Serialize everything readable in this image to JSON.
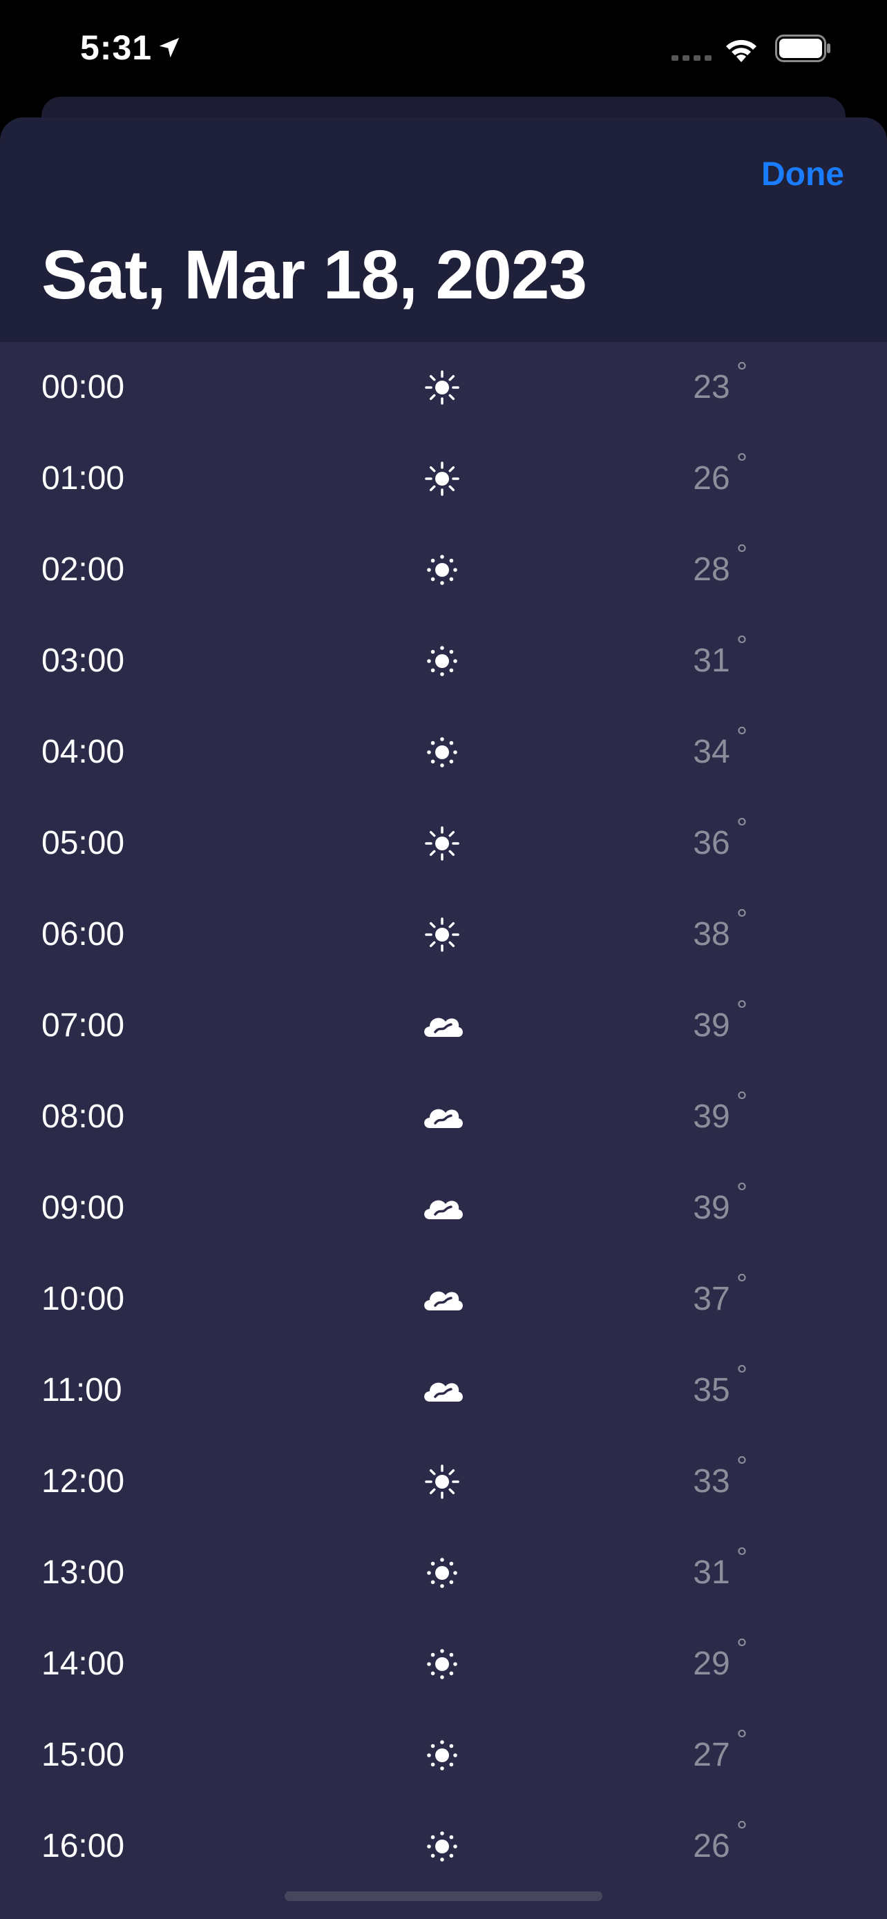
{
  "status_bar": {
    "time": "5:31",
    "location_icon": "location-arrow-icon",
    "signal_icon": "cellular-signal-icon",
    "wifi_icon": "wifi-icon",
    "battery_icon": "battery-icon"
  },
  "header": {
    "done_label": "Done",
    "title": "Sat, Mar 18, 2023"
  },
  "colors": {
    "accent": "#1a7cff",
    "header_bg": "#1f2039",
    "list_bg": "#2b2b49",
    "temp_text": "#8d8d9b"
  },
  "degree_symbol": "°",
  "hours": [
    {
      "time": "00:00",
      "icon": "sun",
      "temp": "23"
    },
    {
      "time": "01:00",
      "icon": "sun",
      "temp": "26"
    },
    {
      "time": "02:00",
      "icon": "sun-dotted",
      "temp": "28"
    },
    {
      "time": "03:00",
      "icon": "sun-dotted",
      "temp": "31"
    },
    {
      "time": "04:00",
      "icon": "sun-dotted",
      "temp": "34"
    },
    {
      "time": "05:00",
      "icon": "sun",
      "temp": "36"
    },
    {
      "time": "06:00",
      "icon": "sun",
      "temp": "38"
    },
    {
      "time": "07:00",
      "icon": "cloud-wind",
      "temp": "39"
    },
    {
      "time": "08:00",
      "icon": "cloud-wind",
      "temp": "39"
    },
    {
      "time": "09:00",
      "icon": "cloud-wind",
      "temp": "39"
    },
    {
      "time": "10:00",
      "icon": "cloud-wind",
      "temp": "37"
    },
    {
      "time": "11:00",
      "icon": "cloud-wind",
      "temp": "35"
    },
    {
      "time": "12:00",
      "icon": "sun",
      "temp": "33"
    },
    {
      "time": "13:00",
      "icon": "sun-dotted",
      "temp": "31"
    },
    {
      "time": "14:00",
      "icon": "sun-dotted",
      "temp": "29"
    },
    {
      "time": "15:00",
      "icon": "sun-dotted",
      "temp": "27"
    },
    {
      "time": "16:00",
      "icon": "sun-dotted",
      "temp": "26"
    }
  ]
}
